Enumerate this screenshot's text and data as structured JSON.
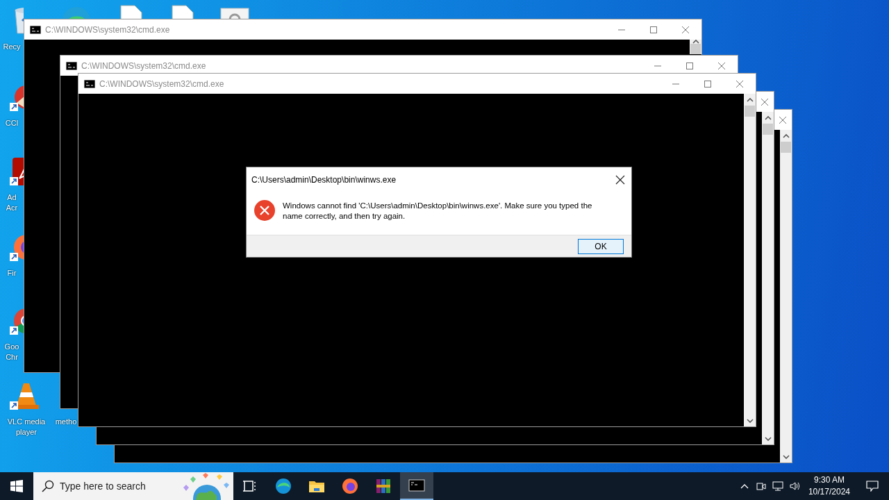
{
  "desktop_icons": [
    {
      "kind": "recycle-bin",
      "lines": [
        "Recy"
      ]
    },
    {
      "kind": "ccleaner",
      "lines": [
        "CCl"
      ]
    },
    {
      "kind": "acrobat",
      "lines": [
        "Ad",
        "Acr"
      ]
    },
    {
      "kind": "firefox",
      "lines": [
        "Fir"
      ]
    },
    {
      "kind": "chrome",
      "lines": [
        "Goo",
        "Chr"
      ]
    },
    {
      "kind": "vlc",
      "lines": [
        "VLC media",
        "player"
      ]
    },
    {
      "lines": [
        "metho"
      ]
    }
  ],
  "top_icons": [
    {
      "kind": "edge"
    },
    {
      "kind": "document"
    },
    {
      "kind": "document"
    },
    {
      "kind": "settings"
    }
  ],
  "windows": [
    {
      "title": "C:\\WINDOWS\\system32\\cmd.exe",
      "controls": [
        {
          "kind": "minimize"
        },
        {
          "kind": "maximize"
        },
        {
          "kind": "close"
        }
      ],
      "scrollbar": {
        "kind": "top"
      }
    },
    {
      "title": "C:\\WINDOWS\\system32\\cmd.exe",
      "controls": [
        {
          "kind": "minimize"
        },
        {
          "kind": "maximize"
        },
        {
          "kind": "close"
        }
      ]
    },
    {
      "title": "C:\\WINDOWS\\system32\\cmd.exe",
      "controls": [
        {
          "kind": "minimize"
        },
        {
          "kind": "maximize"
        },
        {
          "kind": "close"
        }
      ],
      "scrollbar": {
        "kind": "full"
      }
    },
    {
      "controls": [
        {
          "kind": "close"
        }
      ],
      "scrollbar": {
        "kind": "full"
      }
    },
    {
      "controls": [
        {
          "kind": "close"
        }
      ],
      "scrollbar": {
        "kind": "full"
      }
    }
  ],
  "dialog": {
    "title": "C:\\Users\\admin\\Desktop\\bin\\winws.exe",
    "message": "Windows cannot find 'C:\\Users\\admin\\Desktop\\bin\\winws.exe'. Make sure you typed the name correctly, and then try again.",
    "button": "OK"
  },
  "taskbar": {
    "search": {
      "placeholder": "Type here to search"
    },
    "apps": [
      {
        "kind": "task-view",
        "selected": false
      },
      {
        "kind": "edge",
        "selected": false
      },
      {
        "kind": "explorer",
        "selected": false
      },
      {
        "kind": "firefox",
        "selected": false
      },
      {
        "kind": "winrar",
        "selected": false
      },
      {
        "kind": "cmd",
        "selected": true
      }
    ],
    "tray": [
      {
        "kind": "chevron"
      },
      {
        "kind": "meet"
      },
      {
        "kind": "network"
      },
      {
        "kind": "volume"
      }
    ],
    "time": "9:30 AM",
    "date": "10/17/2024"
  }
}
